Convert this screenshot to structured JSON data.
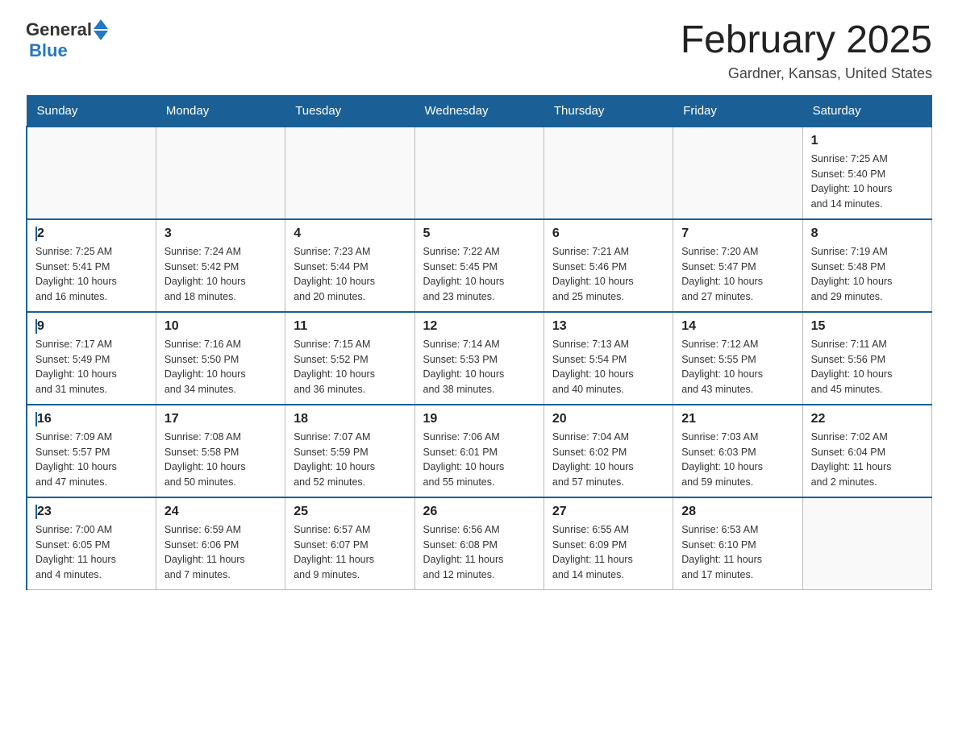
{
  "header": {
    "logo_general": "General",
    "logo_blue": "Blue",
    "month_title": "February 2025",
    "location": "Gardner, Kansas, United States"
  },
  "days_of_week": [
    "Sunday",
    "Monday",
    "Tuesday",
    "Wednesday",
    "Thursday",
    "Friday",
    "Saturday"
  ],
  "weeks": [
    [
      {
        "day": "",
        "info": ""
      },
      {
        "day": "",
        "info": ""
      },
      {
        "day": "",
        "info": ""
      },
      {
        "day": "",
        "info": ""
      },
      {
        "day": "",
        "info": ""
      },
      {
        "day": "",
        "info": ""
      },
      {
        "day": "1",
        "info": "Sunrise: 7:25 AM\nSunset: 5:40 PM\nDaylight: 10 hours\nand 14 minutes."
      }
    ],
    [
      {
        "day": "2",
        "info": "Sunrise: 7:25 AM\nSunset: 5:41 PM\nDaylight: 10 hours\nand 16 minutes."
      },
      {
        "day": "3",
        "info": "Sunrise: 7:24 AM\nSunset: 5:42 PM\nDaylight: 10 hours\nand 18 minutes."
      },
      {
        "day": "4",
        "info": "Sunrise: 7:23 AM\nSunset: 5:44 PM\nDaylight: 10 hours\nand 20 minutes."
      },
      {
        "day": "5",
        "info": "Sunrise: 7:22 AM\nSunset: 5:45 PM\nDaylight: 10 hours\nand 23 minutes."
      },
      {
        "day": "6",
        "info": "Sunrise: 7:21 AM\nSunset: 5:46 PM\nDaylight: 10 hours\nand 25 minutes."
      },
      {
        "day": "7",
        "info": "Sunrise: 7:20 AM\nSunset: 5:47 PM\nDaylight: 10 hours\nand 27 minutes."
      },
      {
        "day": "8",
        "info": "Sunrise: 7:19 AM\nSunset: 5:48 PM\nDaylight: 10 hours\nand 29 minutes."
      }
    ],
    [
      {
        "day": "9",
        "info": "Sunrise: 7:17 AM\nSunset: 5:49 PM\nDaylight: 10 hours\nand 31 minutes."
      },
      {
        "day": "10",
        "info": "Sunrise: 7:16 AM\nSunset: 5:50 PM\nDaylight: 10 hours\nand 34 minutes."
      },
      {
        "day": "11",
        "info": "Sunrise: 7:15 AM\nSunset: 5:52 PM\nDaylight: 10 hours\nand 36 minutes."
      },
      {
        "day": "12",
        "info": "Sunrise: 7:14 AM\nSunset: 5:53 PM\nDaylight: 10 hours\nand 38 minutes."
      },
      {
        "day": "13",
        "info": "Sunrise: 7:13 AM\nSunset: 5:54 PM\nDaylight: 10 hours\nand 40 minutes."
      },
      {
        "day": "14",
        "info": "Sunrise: 7:12 AM\nSunset: 5:55 PM\nDaylight: 10 hours\nand 43 minutes."
      },
      {
        "day": "15",
        "info": "Sunrise: 7:11 AM\nSunset: 5:56 PM\nDaylight: 10 hours\nand 45 minutes."
      }
    ],
    [
      {
        "day": "16",
        "info": "Sunrise: 7:09 AM\nSunset: 5:57 PM\nDaylight: 10 hours\nand 47 minutes."
      },
      {
        "day": "17",
        "info": "Sunrise: 7:08 AM\nSunset: 5:58 PM\nDaylight: 10 hours\nand 50 minutes."
      },
      {
        "day": "18",
        "info": "Sunrise: 7:07 AM\nSunset: 5:59 PM\nDaylight: 10 hours\nand 52 minutes."
      },
      {
        "day": "19",
        "info": "Sunrise: 7:06 AM\nSunset: 6:01 PM\nDaylight: 10 hours\nand 55 minutes."
      },
      {
        "day": "20",
        "info": "Sunrise: 7:04 AM\nSunset: 6:02 PM\nDaylight: 10 hours\nand 57 minutes."
      },
      {
        "day": "21",
        "info": "Sunrise: 7:03 AM\nSunset: 6:03 PM\nDaylight: 10 hours\nand 59 minutes."
      },
      {
        "day": "22",
        "info": "Sunrise: 7:02 AM\nSunset: 6:04 PM\nDaylight: 11 hours\nand 2 minutes."
      }
    ],
    [
      {
        "day": "23",
        "info": "Sunrise: 7:00 AM\nSunset: 6:05 PM\nDaylight: 11 hours\nand 4 minutes."
      },
      {
        "day": "24",
        "info": "Sunrise: 6:59 AM\nSunset: 6:06 PM\nDaylight: 11 hours\nand 7 minutes."
      },
      {
        "day": "25",
        "info": "Sunrise: 6:57 AM\nSunset: 6:07 PM\nDaylight: 11 hours\nand 9 minutes."
      },
      {
        "day": "26",
        "info": "Sunrise: 6:56 AM\nSunset: 6:08 PM\nDaylight: 11 hours\nand 12 minutes."
      },
      {
        "day": "27",
        "info": "Sunrise: 6:55 AM\nSunset: 6:09 PM\nDaylight: 11 hours\nand 14 minutes."
      },
      {
        "day": "28",
        "info": "Sunrise: 6:53 AM\nSunset: 6:10 PM\nDaylight: 11 hours\nand 17 minutes."
      },
      {
        "day": "",
        "info": ""
      }
    ]
  ]
}
